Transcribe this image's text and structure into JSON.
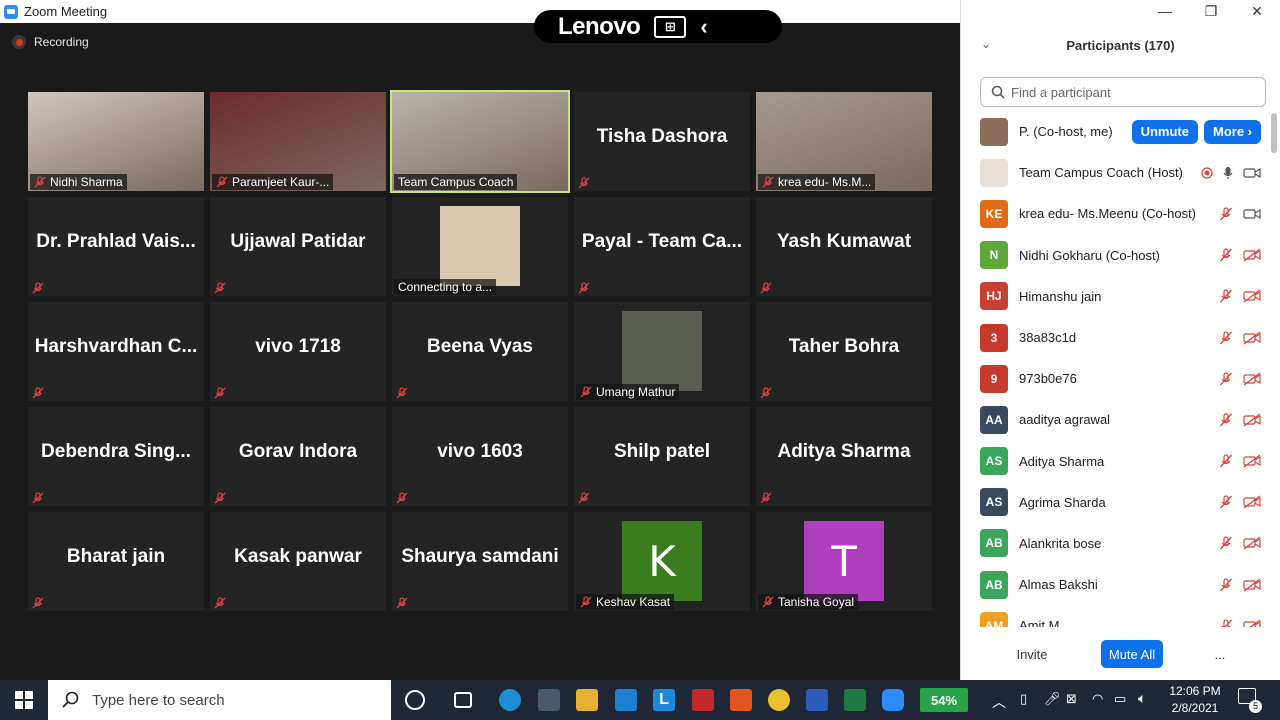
{
  "window": {
    "title": "Zoom Meeting"
  },
  "recording": {
    "label": "Recording"
  },
  "overlay": {
    "brand": "Lenovo"
  },
  "tiles": [
    {
      "name": "Nidhi Sharma",
      "kind": "video",
      "muted": true,
      "bg": "#cfc6c0"
    },
    {
      "name": "Paramjeet Kaur-...",
      "kind": "video",
      "muted": true,
      "bg": "#6e2a2e"
    },
    {
      "name": "Team Campus Coach",
      "kind": "video",
      "muted": false,
      "active": true,
      "bg": "#b9b4ac"
    },
    {
      "name": "Tisha Dashora",
      "kind": "name",
      "muted": true
    },
    {
      "name": "krea edu- Ms.M...",
      "kind": "video",
      "muted": true,
      "bg": "#a49a8f"
    },
    {
      "name": "Dr. Prahlad Vais...",
      "kind": "name",
      "muted": true
    },
    {
      "name": "Ujjawal Patidar",
      "kind": "name",
      "muted": true
    },
    {
      "name": "Connecting to a...",
      "kind": "photo",
      "muted": false,
      "bg": "#d9c9b0"
    },
    {
      "name": "Payal - Team Ca...",
      "kind": "name",
      "muted": true
    },
    {
      "name": "Yash Kumawat",
      "kind": "name",
      "muted": true
    },
    {
      "name": "Harshvardhan C...",
      "kind": "name",
      "muted": true
    },
    {
      "name": "vivo 1718",
      "kind": "name",
      "muted": true
    },
    {
      "name": "Beena Vyas",
      "kind": "name",
      "muted": true
    },
    {
      "name": "Umang Mathur",
      "kind": "photo",
      "muted": true,
      "bg": "#5a5f52"
    },
    {
      "name": "Taher Bohra",
      "kind": "name",
      "muted": true
    },
    {
      "name": "Debendra Sing...",
      "kind": "name",
      "muted": true
    },
    {
      "name": "Gorav Indora",
      "kind": "name",
      "muted": true
    },
    {
      "name": "vivo 1603",
      "kind": "name",
      "muted": true
    },
    {
      "name": "Shilp patel",
      "kind": "name",
      "muted": true
    },
    {
      "name": "Aditya Sharma",
      "kind": "name",
      "muted": true
    },
    {
      "name": "Bharat jain",
      "kind": "name",
      "muted": true
    },
    {
      "name": "Kasak panwar",
      "kind": "name",
      "muted": true
    },
    {
      "name": "Shaurya samdani",
      "kind": "name",
      "muted": true
    },
    {
      "name": "Keshav Kasat",
      "kind": "letter",
      "letter": "K",
      "muted": true,
      "bg": "#3a7d1f"
    },
    {
      "name": "Tanisha Goyal",
      "kind": "letter",
      "letter": "T",
      "muted": true,
      "bg": "#b03fc0"
    }
  ],
  "participants_panel": {
    "title": "Participants (170)",
    "search_placeholder": "Find a participant",
    "rows": [
      {
        "initials": "",
        "name": "P. (Co-host, me)",
        "color": "#8a6d5a",
        "me": true,
        "unmute": "Unmute",
        "more": "More"
      },
      {
        "initials": "",
        "name": "Team Campus Coach (Host)",
        "color": "#e8e0d8",
        "host": true
      },
      {
        "initials": "KE",
        "name": "krea edu- Ms.Meenu (Co-host)",
        "color": "#e06a16",
        "video": true
      },
      {
        "initials": "N",
        "name": "Nidhi Gokharu (Co-host)",
        "color": "#5fa83a"
      },
      {
        "initials": "HJ",
        "name": " Himanshu jain",
        "color": "#c84030"
      },
      {
        "initials": "3",
        "name": "38a83c1d",
        "color": "#c8392d"
      },
      {
        "initials": "9",
        "name": "973b0e76",
        "color": "#c8392d"
      },
      {
        "initials": "AA",
        "name": "aaditya agrawal",
        "color": "#3a4a5e"
      },
      {
        "initials": "AS",
        "name": "Aditya Sharma",
        "color": "#3aa65a"
      },
      {
        "initials": "AS",
        "name": "Agrima Sharda",
        "color": "#3a4a5e"
      },
      {
        "initials": "AB",
        "name": "Alankrita bose",
        "color": "#3aa65a"
      },
      {
        "initials": "AB",
        "name": "Almas Bakshi",
        "color": "#3aa65a"
      },
      {
        "initials": "AM",
        "name": "Amit M...",
        "color": "#f0a020"
      }
    ],
    "footer": {
      "invite": "Invite",
      "mute_all": "Mute All",
      "more": "..."
    }
  },
  "taskbar": {
    "search_placeholder": "Type here to search",
    "battery": "54%",
    "time": "12:06 PM",
    "date": "2/8/2021",
    "notification_count": "5"
  }
}
